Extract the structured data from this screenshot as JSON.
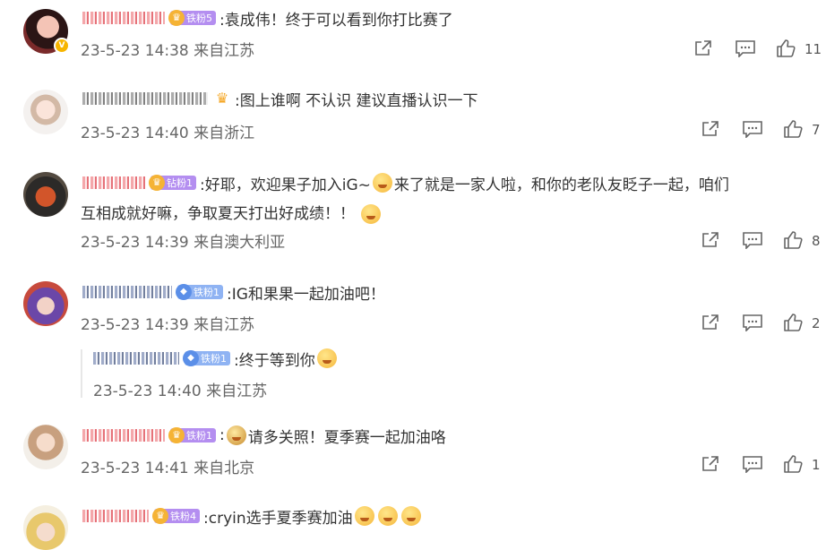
{
  "comments": [
    {
      "badge": "铁粉5",
      "text": ":袁成伟！终于可以看到你打比赛了",
      "time": "23-5-23 14:38 来自江苏",
      "likes": "11"
    },
    {
      "badge": "",
      "text": ":图上谁啊 不认识 建议直播认识一下",
      "time": "23-5-23 14:40 来自浙江",
      "likes": "7"
    },
    {
      "badge": "钻粉1",
      "text_line1": ":好耶，欢迎果子加入iG~",
      "text_line1b": "来了就是一家人啦，和你的老队友眨子一起，咱们",
      "text_line2": "互相成就好嘛，争取夏天打出好成绩！！",
      "time": "23-5-23 14:39 来自澳大利亚",
      "likes": "8"
    },
    {
      "badge": "铁粉1",
      "text": ":IG和果果一起加油吧！",
      "time": "23-5-23 14:39 来自江苏",
      "likes": "2"
    },
    {
      "badge": "铁粉1",
      "text": ":终于等到你",
      "time": "23-5-23 14:40 来自江苏"
    },
    {
      "badge": "铁粉1",
      "text": ":",
      "text_b": "请多关照！夏季赛一起加油咯",
      "time": "23-5-23 14:41 来自北京",
      "likes": "1"
    },
    {
      "badge": "铁粉4",
      "text": ":cryin选手夏季赛加油"
    }
  ],
  "icons": {
    "share": "share-icon",
    "comment": "comment-icon",
    "like": "thumbs-up-icon",
    "verified": "verified-icon",
    "crown": "crown-icon"
  },
  "colors": {
    "time_text": "#666666",
    "body_text": "#333333",
    "fan_badge_blue": "#8fb3f3",
    "fan_badge_purple": "#b48ef0"
  }
}
